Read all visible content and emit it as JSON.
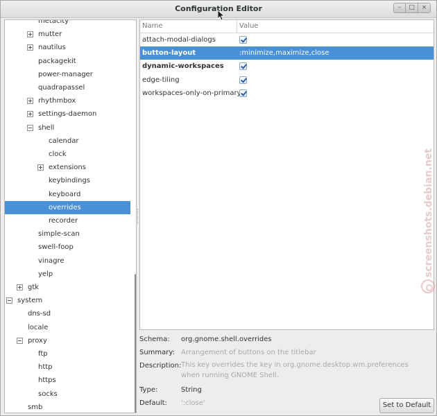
{
  "window": {
    "title": "Configuration Editor",
    "buttons": {
      "minimize": "–",
      "maximize": "□",
      "close": "×"
    }
  },
  "tree": {
    "items": [
      {
        "label": "metacity",
        "level": 2,
        "expander": "none",
        "selected": false
      },
      {
        "label": "mutter",
        "level": 2,
        "expander": "collapsed",
        "selected": false
      },
      {
        "label": "nautilus",
        "level": 2,
        "expander": "collapsed",
        "selected": false
      },
      {
        "label": "packagekit",
        "level": 2,
        "expander": "none",
        "selected": false
      },
      {
        "label": "power-manager",
        "level": 2,
        "expander": "none",
        "selected": false
      },
      {
        "label": "quadrapassel",
        "level": 2,
        "expander": "none",
        "selected": false
      },
      {
        "label": "rhythmbox",
        "level": 2,
        "expander": "collapsed",
        "selected": false
      },
      {
        "label": "settings-daemon",
        "level": 2,
        "expander": "collapsed",
        "selected": false
      },
      {
        "label": "shell",
        "level": 2,
        "expander": "expanded",
        "selected": false
      },
      {
        "label": "calendar",
        "level": 3,
        "expander": "none",
        "selected": false
      },
      {
        "label": "clock",
        "level": 3,
        "expander": "none",
        "selected": false
      },
      {
        "label": "extensions",
        "level": 3,
        "expander": "collapsed",
        "selected": false
      },
      {
        "label": "keybindings",
        "level": 3,
        "expander": "none",
        "selected": false
      },
      {
        "label": "keyboard",
        "level": 3,
        "expander": "none",
        "selected": false
      },
      {
        "label": "overrides",
        "level": 3,
        "expander": "none",
        "selected": true
      },
      {
        "label": "recorder",
        "level": 3,
        "expander": "none",
        "selected": false
      },
      {
        "label": "simple-scan",
        "level": 2,
        "expander": "none",
        "selected": false
      },
      {
        "label": "swell-foop",
        "level": 2,
        "expander": "none",
        "selected": false
      },
      {
        "label": "vinagre",
        "level": 2,
        "expander": "none",
        "selected": false
      },
      {
        "label": "yelp",
        "level": 2,
        "expander": "none",
        "selected": false
      },
      {
        "label": "gtk",
        "level": 1,
        "expander": "collapsed",
        "selected": false
      },
      {
        "label": "system",
        "level": 0,
        "expander": "expanded",
        "selected": false
      },
      {
        "label": "dns-sd",
        "level": 1,
        "expander": "none",
        "selected": false
      },
      {
        "label": "locale",
        "level": 1,
        "expander": "none",
        "selected": false
      },
      {
        "label": "proxy",
        "level": 1,
        "expander": "expanded",
        "selected": false
      },
      {
        "label": "ftp",
        "level": 2,
        "expander": "none",
        "selected": false
      },
      {
        "label": "http",
        "level": 2,
        "expander": "none",
        "selected": false
      },
      {
        "label": "https",
        "level": 2,
        "expander": "none",
        "selected": false
      },
      {
        "label": "socks",
        "level": 2,
        "expander": "none",
        "selected": false
      },
      {
        "label": "smb",
        "level": 1,
        "expander": "none",
        "selected": false
      }
    ]
  },
  "keys": {
    "columns": {
      "name": "Name",
      "value": "Value"
    },
    "rows": [
      {
        "name": "attach-modal-dialogs",
        "value_type": "checkbox",
        "checked": true,
        "value": "",
        "bold": false,
        "selected": false
      },
      {
        "name": "button-layout",
        "value_type": "text",
        "checked": false,
        "value": ":minimize,maximize,close",
        "bold": true,
        "selected": true
      },
      {
        "name": "dynamic-workspaces",
        "value_type": "checkbox",
        "checked": true,
        "value": "",
        "bold": true,
        "selected": false
      },
      {
        "name": "edge-tiling",
        "value_type": "checkbox",
        "checked": true,
        "value": "",
        "bold": false,
        "selected": false
      },
      {
        "name": "workspaces-only-on-primary",
        "value_type": "checkbox",
        "checked": true,
        "value": "",
        "bold": false,
        "selected": false
      }
    ]
  },
  "details": {
    "schema_label": "Schema:",
    "schema_value": "org.gnome.shell.overrides",
    "summary_label": "Summary:",
    "summary_value": "Arrangement of buttons on the titlebar",
    "description_label": "Description:",
    "description_value": "This key overrides the key in org.gnome.desktop.wm.preferences when running GNOME Shell.",
    "type_label": "Type:",
    "type_value": "String",
    "default_label": "Default:",
    "default_value": "':close'",
    "set_default_button": "Set to Default"
  },
  "watermark": {
    "text": "screenshots.debian.net"
  },
  "colors": {
    "selection": "#4a90d9",
    "window_bg": "#ededed",
    "muted_text": "#a9a9a9"
  }
}
